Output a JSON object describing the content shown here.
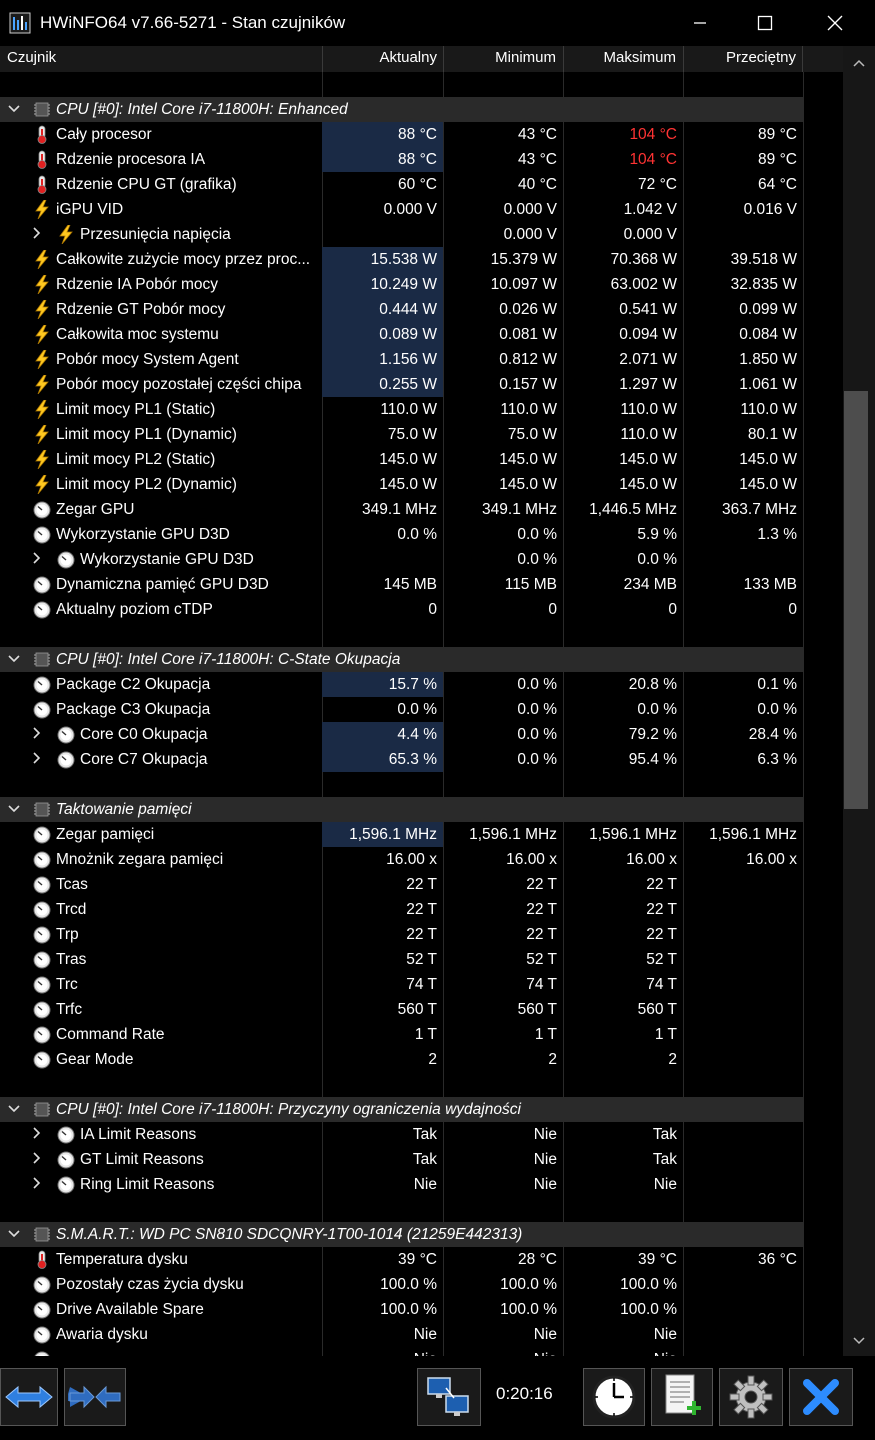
{
  "window": {
    "title": "HWiNFO64 v7.66-5271 - Stan czujników",
    "minimize": "—",
    "maximize": "☐",
    "close": "✕"
  },
  "columns": {
    "sensor": "Czujnik",
    "current": "Aktualny",
    "min": "Minimum",
    "max": "Maksimum",
    "avg": "Przeciętny"
  },
  "colors": {
    "highlight": "#1a2a45",
    "group_bg": "#2a2a2a",
    "red_value": "#ff3333",
    "accent_blue": "#1e6fd9"
  },
  "rows": [
    {
      "type": "spacer"
    },
    {
      "type": "group",
      "name": "CPU [#0]: Intel Core i7-11800H: Enhanced",
      "icon": "chip-icon"
    },
    {
      "type": "sensor",
      "icon": "thermometer-icon",
      "name": "Cały procesor",
      "cur": "88 °C",
      "min": "43 °C",
      "max": "104 °C",
      "avg": "89 °C",
      "hl": true,
      "max_red": true
    },
    {
      "type": "sensor",
      "icon": "thermometer-icon",
      "name": "Rdzenie procesora IA",
      "cur": "88 °C",
      "min": "43 °C",
      "max": "104 °C",
      "avg": "89 °C",
      "hl": true,
      "max_red": true
    },
    {
      "type": "sensor",
      "icon": "thermometer-icon",
      "name": "Rdzenie CPU GT (grafika)",
      "cur": "60 °C",
      "min": "40 °C",
      "max": "72 °C",
      "avg": "64 °C"
    },
    {
      "type": "sensor",
      "icon": "lightning-icon",
      "name": "iGPU VID",
      "cur": "0.000 V",
      "min": "0.000 V",
      "max": "1.042 V",
      "avg": "0.016 V"
    },
    {
      "type": "sensor",
      "icon": "lightning-icon",
      "name": "Przesunięcia napięcia",
      "cur": "",
      "min": "0.000 V",
      "max": "0.000 V",
      "avg": "",
      "child": true
    },
    {
      "type": "sensor",
      "icon": "lightning-icon",
      "name": "Całkowite zużycie mocy przez proc...",
      "cur": "15.538 W",
      "min": "15.379 W",
      "max": "70.368 W",
      "avg": "39.518 W",
      "hl": true
    },
    {
      "type": "sensor",
      "icon": "lightning-icon",
      "name": "Rdzenie IA Pobór mocy",
      "cur": "10.249 W",
      "min": "10.097 W",
      "max": "63.002 W",
      "avg": "32.835 W",
      "hl": true
    },
    {
      "type": "sensor",
      "icon": "lightning-icon",
      "name": "Rdzenie GT Pobór mocy",
      "cur": "0.444 W",
      "min": "0.026 W",
      "max": "0.541 W",
      "avg": "0.099 W",
      "hl": true
    },
    {
      "type": "sensor",
      "icon": "lightning-icon",
      "name": "Całkowita moc systemu",
      "cur": "0.089 W",
      "min": "0.081 W",
      "max": "0.094 W",
      "avg": "0.084 W",
      "hl": true
    },
    {
      "type": "sensor",
      "icon": "lightning-icon",
      "name": "Pobór mocy System Agent",
      "cur": "1.156 W",
      "min": "0.812 W",
      "max": "2.071 W",
      "avg": "1.850 W",
      "hl": true
    },
    {
      "type": "sensor",
      "icon": "lightning-icon",
      "name": "Pobór mocy pozostałej części chipa",
      "cur": "0.255 W",
      "min": "0.157 W",
      "max": "1.297 W",
      "avg": "1.061 W",
      "hl": true
    },
    {
      "type": "sensor",
      "icon": "lightning-icon",
      "name": "Limit mocy PL1 (Static)",
      "cur": "110.0 W",
      "min": "110.0 W",
      "max": "110.0 W",
      "avg": "110.0 W"
    },
    {
      "type": "sensor",
      "icon": "lightning-icon",
      "name": "Limit mocy PL1 (Dynamic)",
      "cur": "75.0 W",
      "min": "75.0 W",
      "max": "110.0 W",
      "avg": "80.1 W"
    },
    {
      "type": "sensor",
      "icon": "lightning-icon",
      "name": "Limit mocy PL2 (Static)",
      "cur": "145.0 W",
      "min": "145.0 W",
      "max": "145.0 W",
      "avg": "145.0 W"
    },
    {
      "type": "sensor",
      "icon": "lightning-icon",
      "name": "Limit mocy PL2 (Dynamic)",
      "cur": "145.0 W",
      "min": "145.0 W",
      "max": "145.0 W",
      "avg": "145.0 W"
    },
    {
      "type": "sensor",
      "icon": "gauge-icon",
      "name": "Zegar GPU",
      "cur": "349.1 MHz",
      "min": "349.1 MHz",
      "max": "1,446.5 MHz",
      "avg": "363.7 MHz"
    },
    {
      "type": "sensor",
      "icon": "gauge-icon",
      "name": "Wykorzystanie GPU D3D",
      "cur": "0.0 %",
      "min": "0.0 %",
      "max": "5.9 %",
      "avg": "1.3 %"
    },
    {
      "type": "sensor",
      "icon": "gauge-icon",
      "name": "Wykorzystanie GPU D3D",
      "cur": "",
      "min": "0.0 %",
      "max": "0.0 %",
      "avg": "",
      "child": true
    },
    {
      "type": "sensor",
      "icon": "gauge-icon",
      "name": "Dynamiczna pamięć GPU D3D",
      "cur": "145 MB",
      "min": "115 MB",
      "max": "234 MB",
      "avg": "133 MB"
    },
    {
      "type": "sensor",
      "icon": "gauge-icon",
      "name": "Aktualny poziom cTDP",
      "cur": "0",
      "min": "0",
      "max": "0",
      "avg": "0"
    },
    {
      "type": "spacer"
    },
    {
      "type": "group",
      "name": "CPU [#0]: Intel Core i7-11800H: C-State Okupacja",
      "icon": "chip-icon"
    },
    {
      "type": "sensor",
      "icon": "gauge-icon",
      "name": "Package C2 Okupacja",
      "cur": "15.7 %",
      "min": "0.0 %",
      "max": "20.8 %",
      "avg": "0.1 %",
      "hl": true
    },
    {
      "type": "sensor",
      "icon": "gauge-icon",
      "name": "Package C3 Okupacja",
      "cur": "0.0 %",
      "min": "0.0 %",
      "max": "0.0 %",
      "avg": "0.0 %"
    },
    {
      "type": "sensor",
      "icon": "gauge-icon",
      "name": "Core C0 Okupacja",
      "cur": "4.4 %",
      "min": "0.0 %",
      "max": "79.2 %",
      "avg": "28.4 %",
      "hl": true,
      "child": true
    },
    {
      "type": "sensor",
      "icon": "gauge-icon",
      "name": "Core C7 Okupacja",
      "cur": "65.3 %",
      "min": "0.0 %",
      "max": "95.4 %",
      "avg": "6.3 %",
      "hl": true,
      "child": true
    },
    {
      "type": "spacer"
    },
    {
      "type": "group",
      "name": "Taktowanie pamięci",
      "icon": "chip-icon"
    },
    {
      "type": "sensor",
      "icon": "gauge-icon",
      "name": "Zegar pamięci",
      "cur": "1,596.1 MHz",
      "min": "1,596.1 MHz",
      "max": "1,596.1 MHz",
      "avg": "1,596.1 MHz",
      "hl": true
    },
    {
      "type": "sensor",
      "icon": "gauge-icon",
      "name": "Mnożnik zegara pamięci",
      "cur": "16.00 x",
      "min": "16.00 x",
      "max": "16.00 x",
      "avg": "16.00 x"
    },
    {
      "type": "sensor",
      "icon": "gauge-icon",
      "name": "Tcas",
      "cur": "22 T",
      "min": "22 T",
      "max": "22 T",
      "avg": ""
    },
    {
      "type": "sensor",
      "icon": "gauge-icon",
      "name": "Trcd",
      "cur": "22 T",
      "min": "22 T",
      "max": "22 T",
      "avg": ""
    },
    {
      "type": "sensor",
      "icon": "gauge-icon",
      "name": "Trp",
      "cur": "22 T",
      "min": "22 T",
      "max": "22 T",
      "avg": ""
    },
    {
      "type": "sensor",
      "icon": "gauge-icon",
      "name": "Tras",
      "cur": "52 T",
      "min": "52 T",
      "max": "52 T",
      "avg": ""
    },
    {
      "type": "sensor",
      "icon": "gauge-icon",
      "name": "Trc",
      "cur": "74 T",
      "min": "74 T",
      "max": "74 T",
      "avg": ""
    },
    {
      "type": "sensor",
      "icon": "gauge-icon",
      "name": "Trfc",
      "cur": "560 T",
      "min": "560 T",
      "max": "560 T",
      "avg": ""
    },
    {
      "type": "sensor",
      "icon": "gauge-icon",
      "name": "Command Rate",
      "cur": "1 T",
      "min": "1 T",
      "max": "1 T",
      "avg": ""
    },
    {
      "type": "sensor",
      "icon": "gauge-icon",
      "name": "Gear Mode",
      "cur": "2",
      "min": "2",
      "max": "2",
      "avg": ""
    },
    {
      "type": "spacer"
    },
    {
      "type": "group",
      "name": "CPU [#0]: Intel Core i7-11800H: Przyczyny ograniczenia wydajności",
      "icon": "chip-icon"
    },
    {
      "type": "sensor",
      "icon": "gauge-icon",
      "name": "IA Limit Reasons",
      "cur": "Tak",
      "min": "Nie",
      "max": "Tak",
      "avg": "",
      "child": true
    },
    {
      "type": "sensor",
      "icon": "gauge-icon",
      "name": "GT Limit Reasons",
      "cur": "Tak",
      "min": "Nie",
      "max": "Tak",
      "avg": "",
      "child": true
    },
    {
      "type": "sensor",
      "icon": "gauge-icon",
      "name": "Ring Limit Reasons",
      "cur": "Nie",
      "min": "Nie",
      "max": "Nie",
      "avg": "",
      "child": true
    },
    {
      "type": "spacer"
    },
    {
      "type": "group",
      "name": "S.M.A.R.T.: WD PC SN810 SDCQNRY-1T00-1014 (21259E442313)",
      "icon": "chip-icon"
    },
    {
      "type": "sensor",
      "icon": "thermometer-icon",
      "name": "Temperatura dysku",
      "cur": "39 °C",
      "min": "28 °C",
      "max": "39 °C",
      "avg": "36 °C"
    },
    {
      "type": "sensor",
      "icon": "gauge-icon",
      "name": "Pozostały czas życia dysku",
      "cur": "100.0 %",
      "min": "100.0 %",
      "max": "100.0 %",
      "avg": ""
    },
    {
      "type": "sensor",
      "icon": "gauge-icon",
      "name": "Drive Available Spare",
      "cur": "100.0 %",
      "min": "100.0 %",
      "max": "100.0 %",
      "avg": ""
    },
    {
      "type": "sensor",
      "icon": "gauge-icon",
      "name": "Awaria dysku",
      "cur": "Nie",
      "min": "Nie",
      "max": "Nie",
      "avg": ""
    },
    {
      "type": "sensor",
      "icon": "gauge-icon",
      "name": "",
      "cur": "Nie",
      "min": "Nie",
      "max": "Nie",
      "avg": ""
    }
  ],
  "toolbar": {
    "timer": "0:20:16",
    "buttons": [
      "arrows-expand-icon",
      "arrows-collapse-icon",
      "network-icon",
      "clock-icon",
      "report-icon",
      "settings-icon",
      "close-x-icon"
    ]
  }
}
